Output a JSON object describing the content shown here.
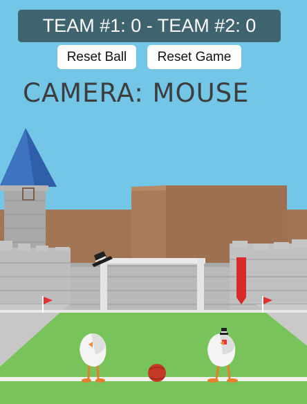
{
  "hud": {
    "score_text": "TEAM #1: 0 - TEAM #2: 0",
    "reset_ball_label": "Reset Ball",
    "reset_game_label": "Reset Game",
    "camera_label": "CAMERA: MOUSE"
  },
  "colors": {
    "sky": "#73c6e6",
    "scoreboard_bg": "#3f6470",
    "grass": "#78c45a",
    "field_line": "#f2f2f2",
    "wall": "#b8b8b8",
    "brick_back": "#a97b5a",
    "ball": "#c53a26",
    "tower_roof": "#3d73bf",
    "flag": "#e23030"
  },
  "icons": [
    "tower",
    "castle-wall",
    "goal",
    "hat",
    "corner-flag",
    "chicken",
    "ball"
  ]
}
